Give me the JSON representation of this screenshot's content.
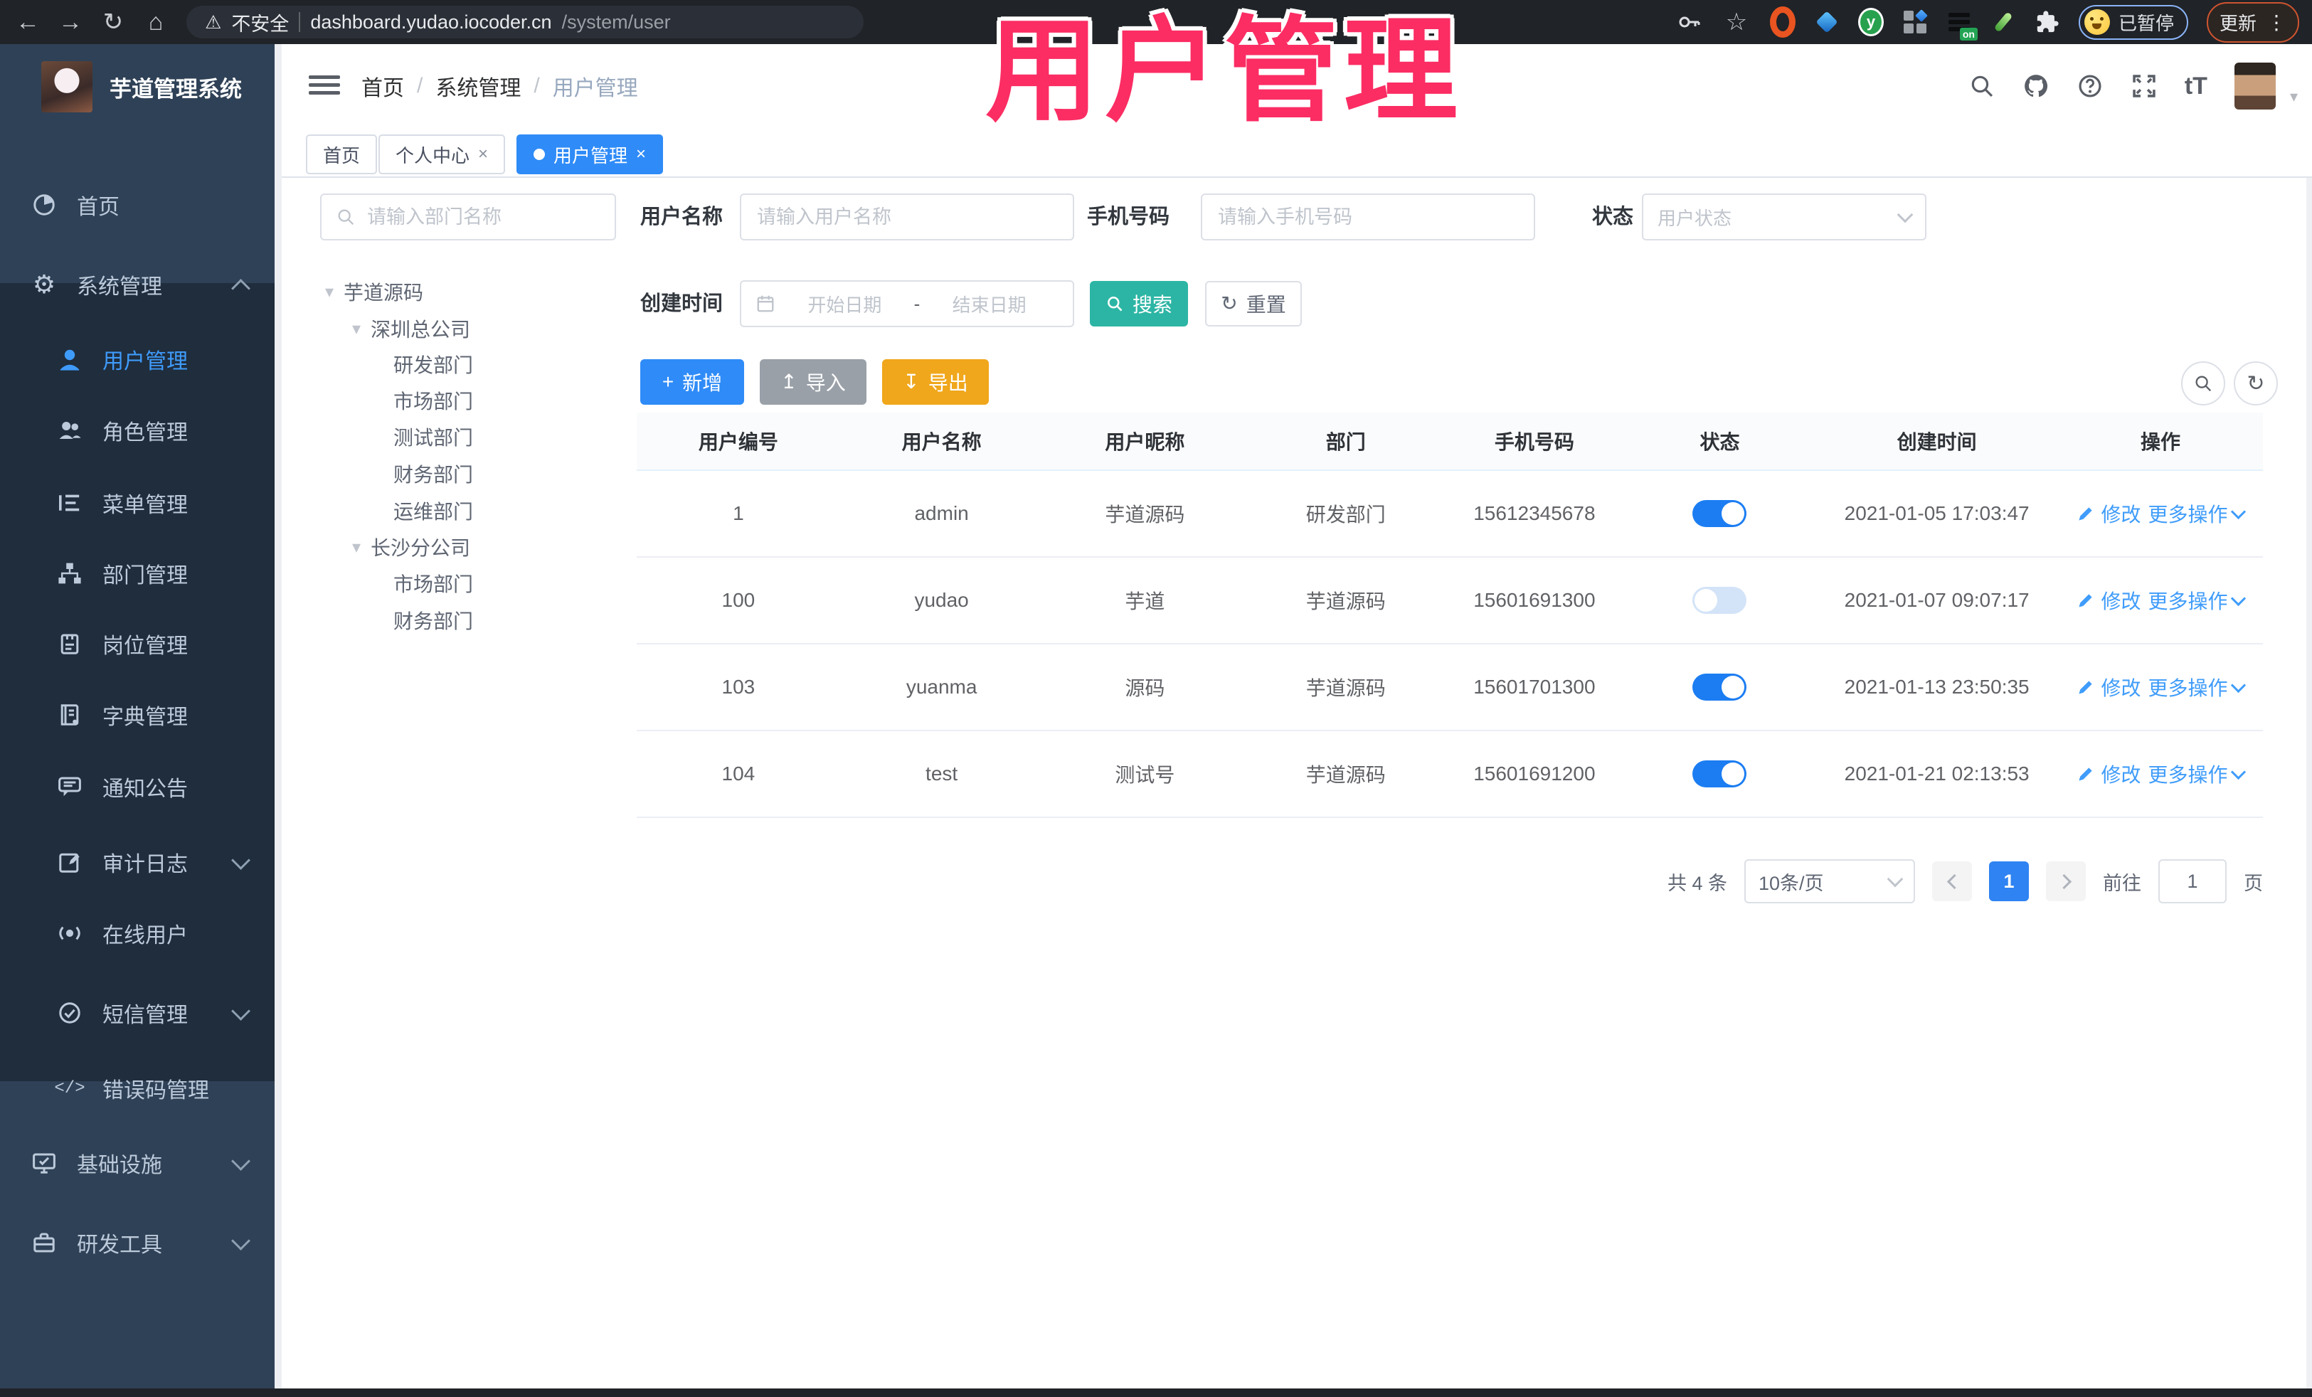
{
  "browser": {
    "security_label": "不安全",
    "url_host": "dashboard.yudao.iocoder.cn",
    "url_path": "/system/user",
    "profile_status": "已暂停",
    "update_label": "更新"
  },
  "icons": {
    "back": "←",
    "forward": "→",
    "reload": "↻",
    "home": "⌂",
    "warning": "⚠",
    "star": "☆",
    "kebab": "⋮",
    "gear": "⚙",
    "tree_caret": "▾",
    "avatar_caret": "▾",
    "close": "×",
    "plus": "+",
    "import_arrow": "↥",
    "export_arrow": "↧",
    "refresh": "↻",
    "code": "</>",
    "font_size": "tT"
  },
  "overlay_title": "用户管理",
  "app": {
    "title": "芋道管理系统"
  },
  "breadcrumb": {
    "items": [
      "首页",
      "系统管理",
      "用户管理"
    ],
    "separator": "/"
  },
  "tabs": [
    {
      "label": "首页"
    },
    {
      "label": "个人中心"
    },
    {
      "label": "用户管理"
    }
  ],
  "sidebar": {
    "items": [
      {
        "label": "首页"
      },
      {
        "label": "系统管理"
      },
      {
        "label": "用户管理"
      },
      {
        "label": "角色管理"
      },
      {
        "label": "菜单管理"
      },
      {
        "label": "部门管理"
      },
      {
        "label": "岗位管理"
      },
      {
        "label": "字典管理"
      },
      {
        "label": "通知公告"
      },
      {
        "label": "审计日志"
      },
      {
        "label": "在线用户"
      },
      {
        "label": "短信管理"
      },
      {
        "label": "错误码管理"
      },
      {
        "label": "基础设施"
      },
      {
        "label": "研发工具"
      }
    ]
  },
  "dept": {
    "search_placeholder": "请输入部门名称",
    "nodes": [
      {
        "label": "芋道源码"
      },
      {
        "label": "深圳总公司"
      },
      {
        "label": "研发部门"
      },
      {
        "label": "市场部门"
      },
      {
        "label": "测试部门"
      },
      {
        "label": "财务部门"
      },
      {
        "label": "运维部门"
      },
      {
        "label": "长沙分公司"
      },
      {
        "label": "市场部门"
      },
      {
        "label": "财务部门"
      }
    ]
  },
  "filters": {
    "username_label": "用户名称",
    "username_placeholder": "请输入用户名称",
    "mobile_label": "手机号码",
    "mobile_placeholder": "请输入手机号码",
    "status_label": "状态",
    "status_placeholder": "用户状态",
    "date_label": "创建时间",
    "date_start_placeholder": "开始日期",
    "date_separator": "-",
    "date_end_placeholder": "结束日期",
    "search_label": "搜索",
    "reset_label": "重置"
  },
  "toolbar": {
    "add_label": "新增",
    "import_label": "导入",
    "export_label": "导出"
  },
  "users": {
    "headers": [
      "用户编号",
      "用户名称",
      "用户昵称",
      "部门",
      "手机号码",
      "状态",
      "创建时间",
      "操作"
    ],
    "edit_label": "修改",
    "more_label": "更多操作",
    "rows": [
      {
        "id": "1",
        "username": "admin",
        "nickname": "芋道源码",
        "dept": "研发部门",
        "mobile": "15612345678",
        "status": "on",
        "created": "2021-01-05 17:03:47"
      },
      {
        "id": "100",
        "username": "yudao",
        "nickname": "芋道",
        "dept": "芋道源码",
        "mobile": "15601691300",
        "status": "off",
        "created": "2021-01-07 09:07:17"
      },
      {
        "id": "103",
        "username": "yuanma",
        "nickname": "源码",
        "dept": "芋道源码",
        "mobile": "15601701300",
        "status": "on",
        "created": "2021-01-13 23:50:35"
      },
      {
        "id": "104",
        "username": "test",
        "nickname": "测试号",
        "dept": "芋道源码",
        "mobile": "15601691200",
        "status": "on",
        "created": "2021-01-21 02:13:53"
      }
    ]
  },
  "pagination": {
    "total": "共 4 条",
    "page_size": "10条/页",
    "current_page": "1",
    "goto_label": "前往",
    "goto_value": "1",
    "page_unit": "页"
  }
}
